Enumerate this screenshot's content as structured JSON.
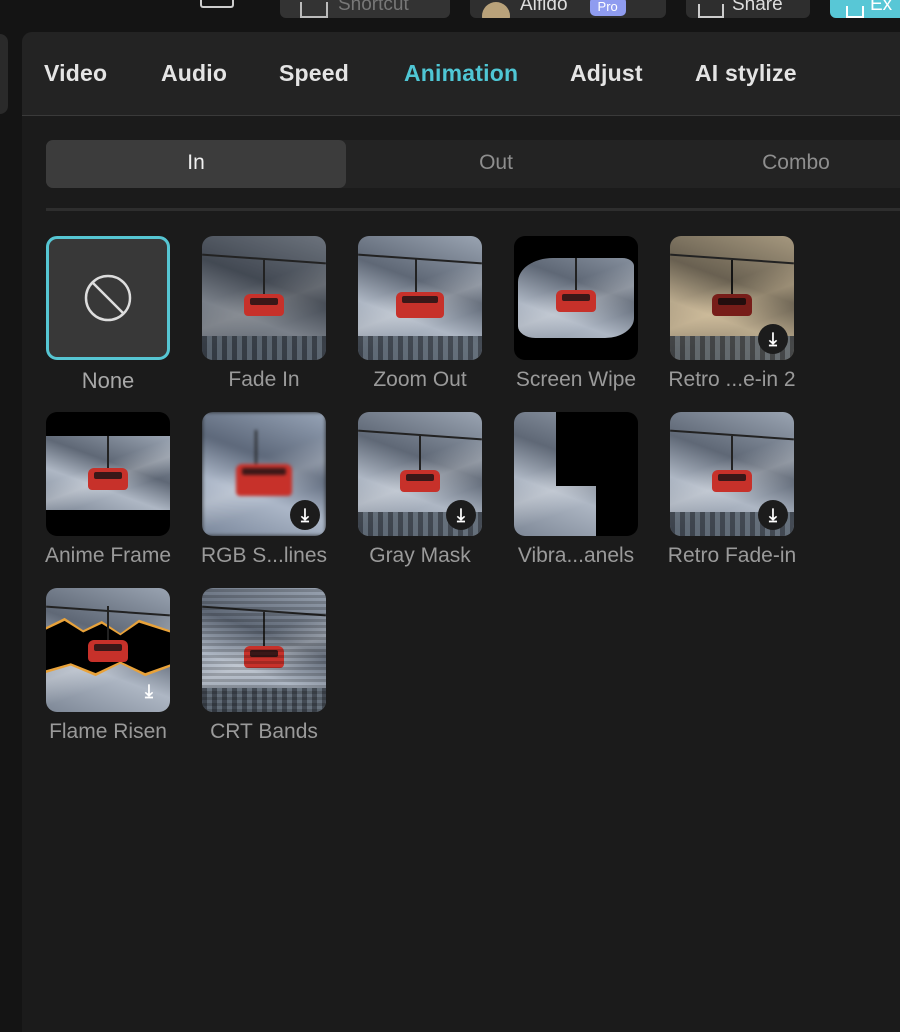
{
  "toolbar": {
    "shortcut_label": "Shortcut",
    "user_name": "Alfido",
    "user_badge": "Pro",
    "share_label": "Share",
    "export_label": "Ex"
  },
  "tabs": [
    {
      "label": "Video"
    },
    {
      "label": "Audio"
    },
    {
      "label": "Speed"
    },
    {
      "label": "Animation"
    },
    {
      "label": "Adjust"
    },
    {
      "label": "AI stylize"
    }
  ],
  "active_tab": "Animation",
  "segments": [
    {
      "label": "In"
    },
    {
      "label": "Out"
    },
    {
      "label": "Combo"
    }
  ],
  "active_segment": "In",
  "colors": {
    "accent": "#4fc6d4",
    "gondola": "#c7312a"
  },
  "animations": [
    {
      "label": "None",
      "icon": "none-icon",
      "selected": true
    },
    {
      "label": "Fade In",
      "download": false
    },
    {
      "label": "Zoom Out",
      "download": false
    },
    {
      "label": "Screen Wipe",
      "download": false
    },
    {
      "label": "Retro ...e-in 2",
      "download": true
    },
    {
      "label": "Anime Frame",
      "download": false
    },
    {
      "label": "RGB S...lines",
      "download": true
    },
    {
      "label": "Gray Mask",
      "download": true
    },
    {
      "label": "Vibra...anels",
      "download": false
    },
    {
      "label": "Retro Fade-in",
      "download": true
    },
    {
      "label": "Flame Risen",
      "download": true
    },
    {
      "label": "CRT Bands",
      "download": false
    }
  ]
}
